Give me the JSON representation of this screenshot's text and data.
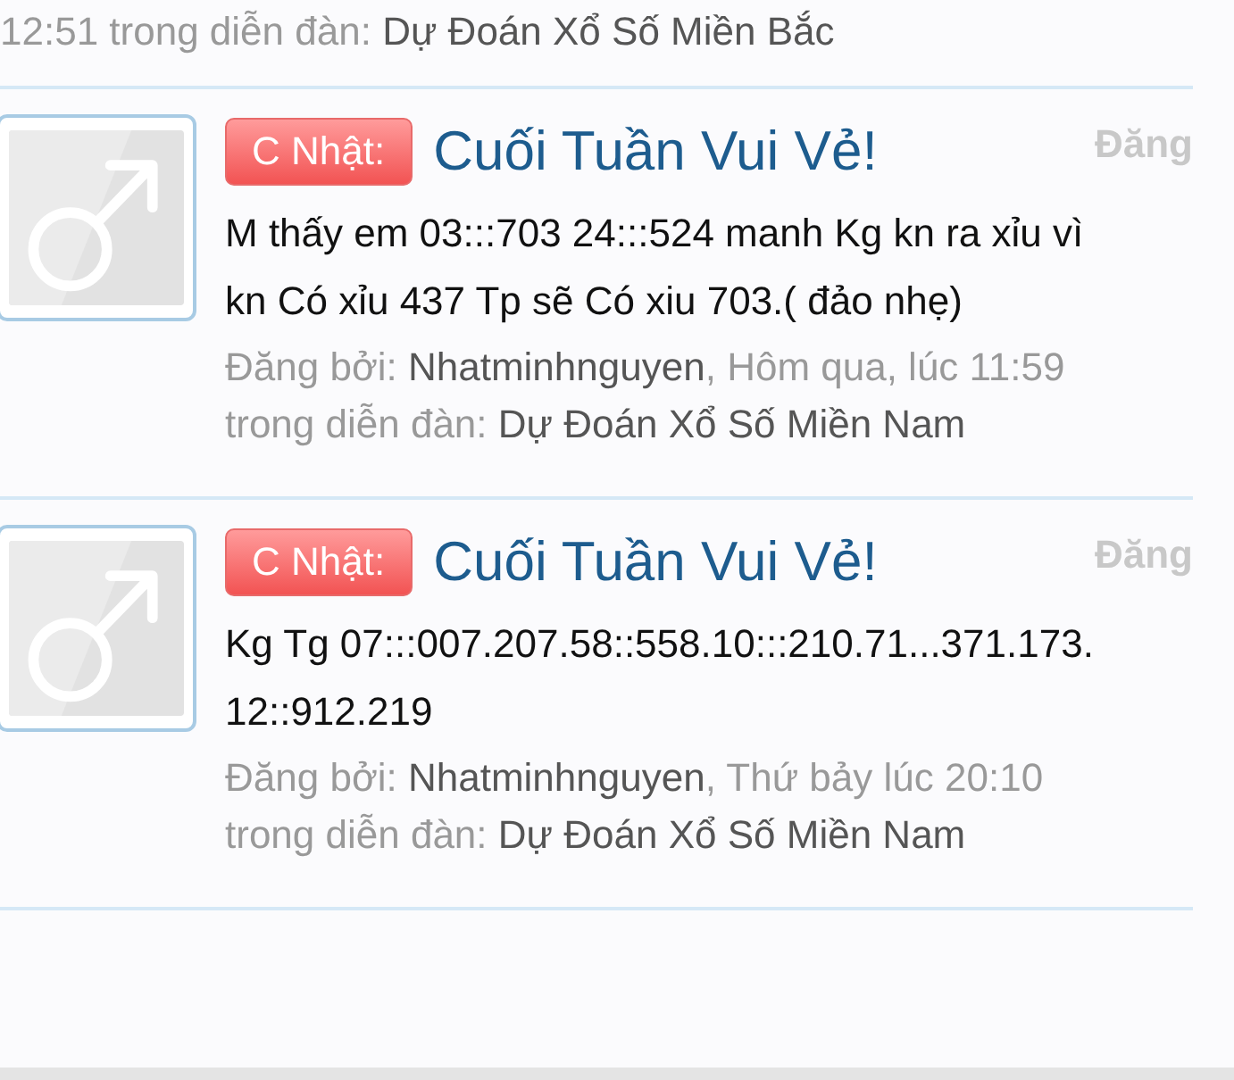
{
  "previous_post_meta": {
    "when": "12:51",
    "forum_label": "trong diễn đàn:",
    "forum": "Dự Đoán Xổ Số Miền Bắc"
  },
  "posts": [
    {
      "prefix": "C Nhật:",
      "title": "Cuối Tuần Vui Vẻ!",
      "side_label": "Đăng",
      "body": "M thấy em 03:::703 24:::524 manh Kg kn ra xỉu vì kn Có xỉu 437 Tp sẽ Có xiu 703.( đảo nhẹ)",
      "posted_by_label": "Đăng bởi:",
      "author": "Nhatminhnguyen",
      "when": ", Hôm qua, lúc 11:59",
      "forum_label": "trong diễn đàn:",
      "forum": "Dự Đoán Xổ Số Miền Nam"
    },
    {
      "prefix": "C Nhật:",
      "title": "Cuối Tuần Vui Vẻ!",
      "side_label": "Đăng",
      "body": "Kg Tg 07:::007.207.58::558.10:::210.71...371.173.12::912.219",
      "posted_by_label": "Đăng bởi:",
      "author": "Nhatminhnguyen",
      "when": ", Thứ bảy lúc 20:10",
      "forum_label": "trong diễn đàn:",
      "forum": "Dự Đoán Xổ Số Miền Nam"
    }
  ]
}
